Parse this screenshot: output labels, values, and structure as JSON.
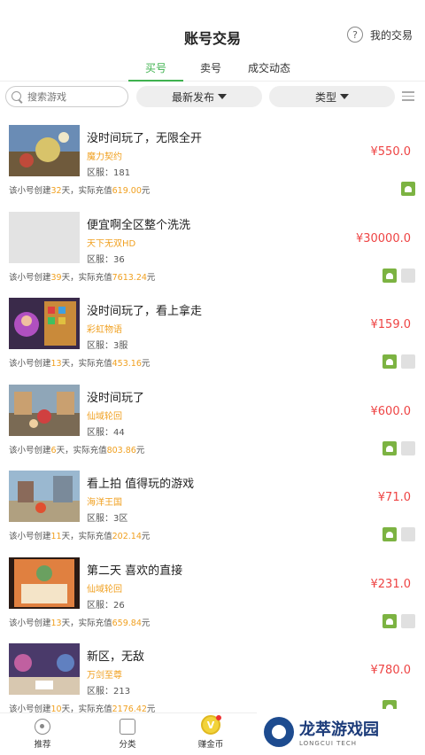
{
  "header": {
    "title": "账号交易",
    "help_glyph": "?",
    "my_trade_label": "我的交易"
  },
  "tabs": [
    {
      "label": "买号",
      "active": true
    },
    {
      "label": "卖号",
      "active": false
    },
    {
      "label": "成交动态",
      "active": false
    }
  ],
  "filters": {
    "search_placeholder": "搜索游戏",
    "sort_label": "最新发布",
    "type_label": "类型"
  },
  "colors": {
    "accent": "#3fb24f",
    "price": "#e44444",
    "game_name": "#f0a020"
  },
  "listings": [
    {
      "title": "没时间玩了，无限全开",
      "game": "魔力契约",
      "server": "区服：181",
      "price": "¥550.0",
      "info_prefix": "该小号创建",
      "days": "32",
      "info_mid": "天，实际充值",
      "amount": "619.00",
      "info_suffix": "元"
    },
    {
      "title": "便宜啊全区整个洗洗",
      "game": "天下无双HD",
      "server": "区服：36",
      "price": "¥30000.0",
      "info_prefix": "该小号创建",
      "days": "39",
      "info_mid": "天，实际充值",
      "amount": "7613.24",
      "info_suffix": "元"
    },
    {
      "title": "没时间玩了，看上拿走",
      "game": "彩虹物语",
      "server": "区服：3服",
      "price": "¥159.0",
      "info_prefix": "该小号创建",
      "days": "13",
      "info_mid": "天，实际充值",
      "amount": "453.16",
      "info_suffix": "元"
    },
    {
      "title": "没时间玩了",
      "game": "仙域轮回",
      "server": "区服：44",
      "price": "¥600.0",
      "info_prefix": "该小号创建",
      "days": "6",
      "info_mid": "天，实际充值",
      "amount": "803.86",
      "info_suffix": "元"
    },
    {
      "title": "看上拍 值得玩的游戏",
      "game": "海洋王国",
      "server": "区服：3区",
      "price": "¥71.0",
      "info_prefix": "该小号创建",
      "days": "11",
      "info_mid": "天，实际充值",
      "amount": "202.14",
      "info_suffix": "元"
    },
    {
      "title": "第二天 喜欢的直接",
      "game": "仙域轮回",
      "server": "区服：26",
      "price": "¥231.0",
      "info_prefix": "该小号创建",
      "days": "13",
      "info_mid": "天，实际充值",
      "amount": "659.84",
      "info_suffix": "元"
    },
    {
      "title": "新区，无敌",
      "game": "万剑至尊",
      "server": "区服：213",
      "price": "¥780.0",
      "info_prefix": "该小号创建",
      "days": "10",
      "info_mid": "天，实际充值",
      "amount": "2176.42",
      "info_suffix": "元"
    }
  ],
  "bottom_nav": [
    {
      "label": "推荐",
      "icon": "recommend-icon"
    },
    {
      "label": "分类",
      "icon": "category-icon"
    },
    {
      "label": "赚金币",
      "icon": "coin-icon"
    }
  ],
  "coin_glyph": "V",
  "watermark": {
    "title": "龙萃游戏园",
    "subtitle": "LONGCUI TECH"
  }
}
